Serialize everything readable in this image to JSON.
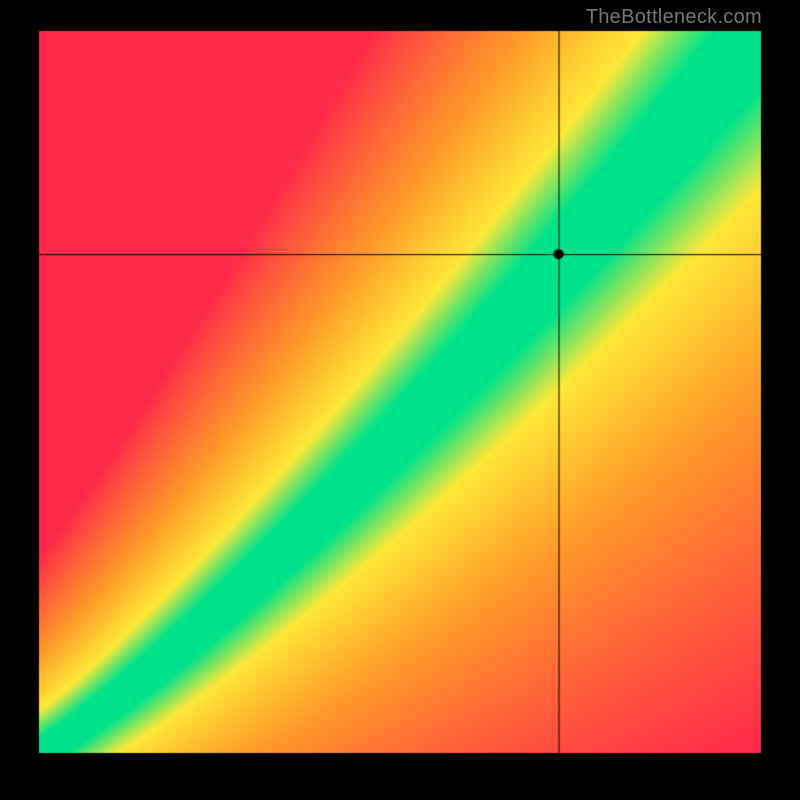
{
  "watermark": "TheBottleneck.com",
  "chart_data": {
    "type": "heatmap",
    "title": "",
    "xlabel": "",
    "ylabel": "",
    "xlim": [
      0,
      1
    ],
    "ylim": [
      0,
      1
    ],
    "crosshair": {
      "x": 0.72,
      "y": 0.69
    },
    "marker": {
      "x": 0.72,
      "y": 0.69
    },
    "optimal_curve_description": "Green band follows a superlinear diagonal from bottom-left to top-right; colors grade green→yellow→orange→red with distance from the band.",
    "curve_samples": [
      {
        "x": 0.0,
        "y": 0.0
      },
      {
        "x": 0.1,
        "y": 0.07
      },
      {
        "x": 0.2,
        "y": 0.15
      },
      {
        "x": 0.3,
        "y": 0.24
      },
      {
        "x": 0.4,
        "y": 0.34
      },
      {
        "x": 0.5,
        "y": 0.45
      },
      {
        "x": 0.6,
        "y": 0.56
      },
      {
        "x": 0.7,
        "y": 0.67
      },
      {
        "x": 0.8,
        "y": 0.79
      },
      {
        "x": 0.9,
        "y": 0.9
      },
      {
        "x": 1.0,
        "y": 1.0
      }
    ],
    "green_band_halfwidth": 0.045,
    "colors": {
      "green": "#00e28a",
      "yellow": "#ffe838",
      "orange": "#ff9a2a",
      "red": "#ff2a4a"
    }
  }
}
